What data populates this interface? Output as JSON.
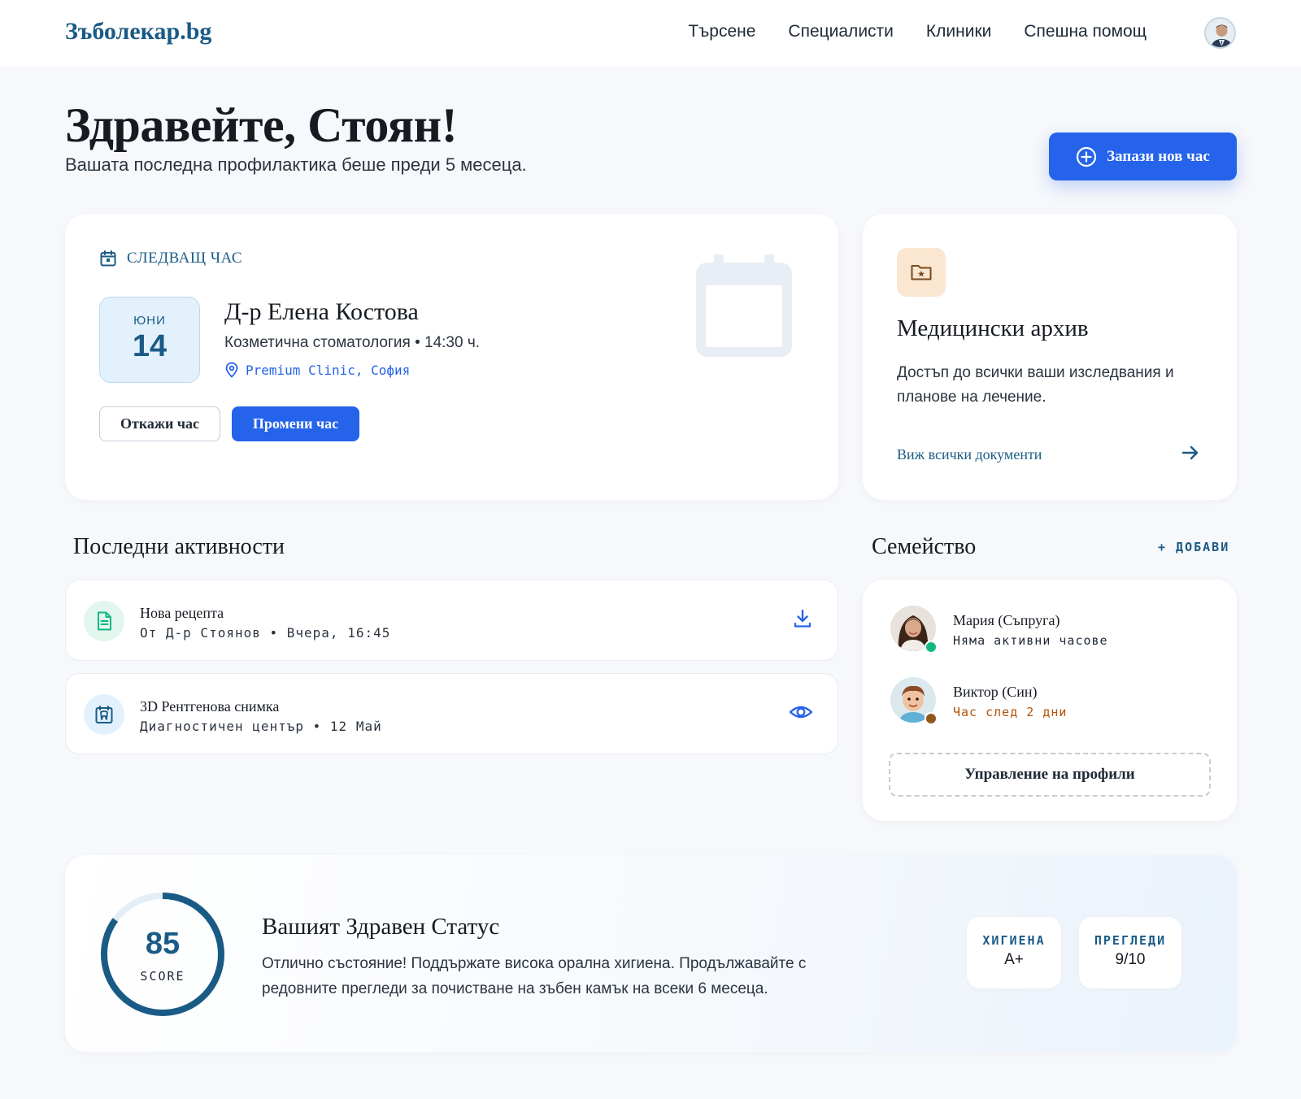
{
  "header": {
    "logo": "Зъболекар.bg",
    "nav": [
      "Търсене",
      "Специалисти",
      "Клиники",
      "Спешна помощ"
    ]
  },
  "greeting": {
    "title": "Здравейте, Стоян!",
    "subtitle": "Вашата последна профилактика беше преди 5 месеца.",
    "book_button": "Запази нов час"
  },
  "next_appointment": {
    "label": "СЛЕДВАЩ ЧАС",
    "month": "ЮНИ",
    "day": "14",
    "doctor": "Д-р Елена Костова",
    "details": "Козметична стоматология • 14:30 ч.",
    "location": "Premium Clinic, София",
    "cancel_button": "Откажи час",
    "change_button": "Промени час"
  },
  "archive": {
    "title": "Медицински архив",
    "description": "Достъп до всички ваши изследвания и планове на лечение.",
    "link": "Виж всички документи"
  },
  "activities": {
    "title": "Последни активности",
    "items": [
      {
        "title": "Нова рецепта",
        "subtitle": "От Д-р Стоянов • Вчера, 16:45",
        "icon": "document-icon",
        "action_icon": "download-icon"
      },
      {
        "title": "3D Рентгенова снимка",
        "subtitle": "Диагностичен център • 12 Май",
        "icon": "xray-icon",
        "action_icon": "eye-icon"
      }
    ]
  },
  "family": {
    "title": "Семейство",
    "add_label": "+ ДОБАВИ",
    "members": [
      {
        "name": "Мария (Съпруга)",
        "status": "Няма активни часове",
        "status_color": "#1f2937",
        "dot_color": "#10b981"
      },
      {
        "name": "Виктор (Син)",
        "status": "Час след 2 дни",
        "status_color": "#b45309",
        "dot_color": "#92571c"
      }
    ],
    "manage_button": "Управление на профили"
  },
  "health": {
    "score": "85",
    "score_label": "SCORE",
    "score_value": 85,
    "title": "Вашият Здравен Статус",
    "description": "Отлично състояние! Поддържате висока орална хигиена. Продължавайте с редовните прегледи за почистване на зъбен камък на всеки 6 месеца.",
    "stats": [
      {
        "label": "ХИГИЕНА",
        "value": "A+"
      },
      {
        "label": "ПРЕГЛЕДИ",
        "value": "9/10"
      }
    ]
  },
  "colors": {
    "primary": "#2563eb",
    "brand": "#1a5b86",
    "background": "#f6f8fb"
  }
}
